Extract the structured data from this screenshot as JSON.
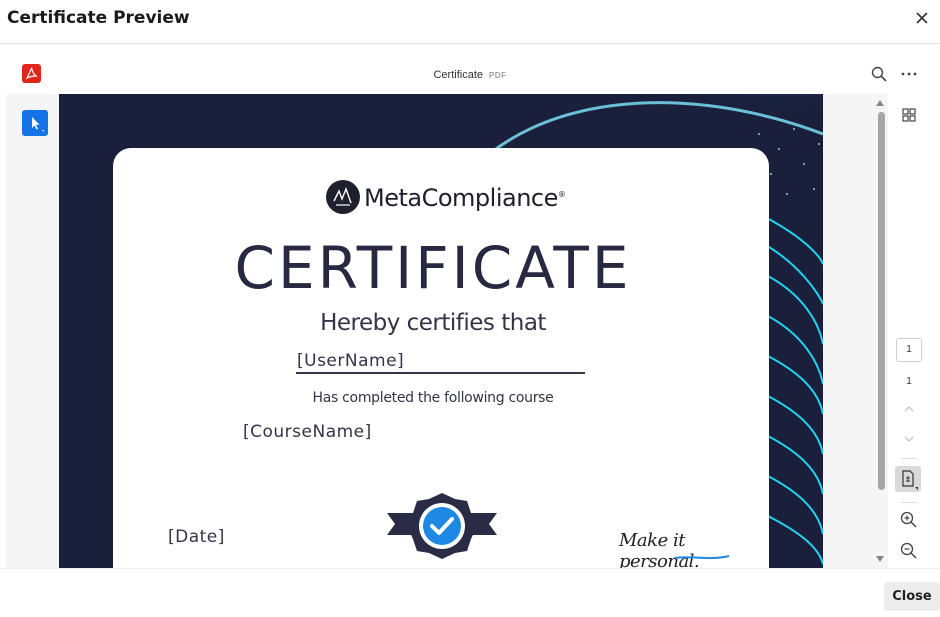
{
  "modal": {
    "title": "Certificate Preview",
    "close_label": "Close"
  },
  "viewer": {
    "doc_name": "Certificate",
    "doc_type": "PDF",
    "current_page": "1",
    "total_pages": "1"
  },
  "certificate": {
    "brand": "MetaCompliance",
    "brand_mark": "®",
    "title": "CERTIFICATE",
    "subtitle": "Hereby certifies that",
    "user_placeholder": "[UserName]",
    "completed_text": "Has completed the following course",
    "course_placeholder": "[CourseName]",
    "date_placeholder": "[Date]",
    "signature": "Make it personal."
  },
  "colors": {
    "accent": "#1473e6",
    "pdf_red": "#e0251b",
    "cert_navy": "#272940",
    "background_dark": "#1a1f3c",
    "swirl_cyan": "#22d3ee",
    "badge_blue": "#1e88e5"
  },
  "icons": {
    "close": "close-icon",
    "pdf": "pdf-icon",
    "search": "search-icon",
    "more": "more-horizontal-icon",
    "select": "pointer-icon",
    "grid": "grid-icon",
    "page_up": "chevron-up-icon",
    "page_down": "chevron-down-icon",
    "fit": "fit-page-icon",
    "zoom_in": "zoom-in-icon",
    "zoom_out": "zoom-out-icon",
    "badge": "check-badge-icon"
  }
}
